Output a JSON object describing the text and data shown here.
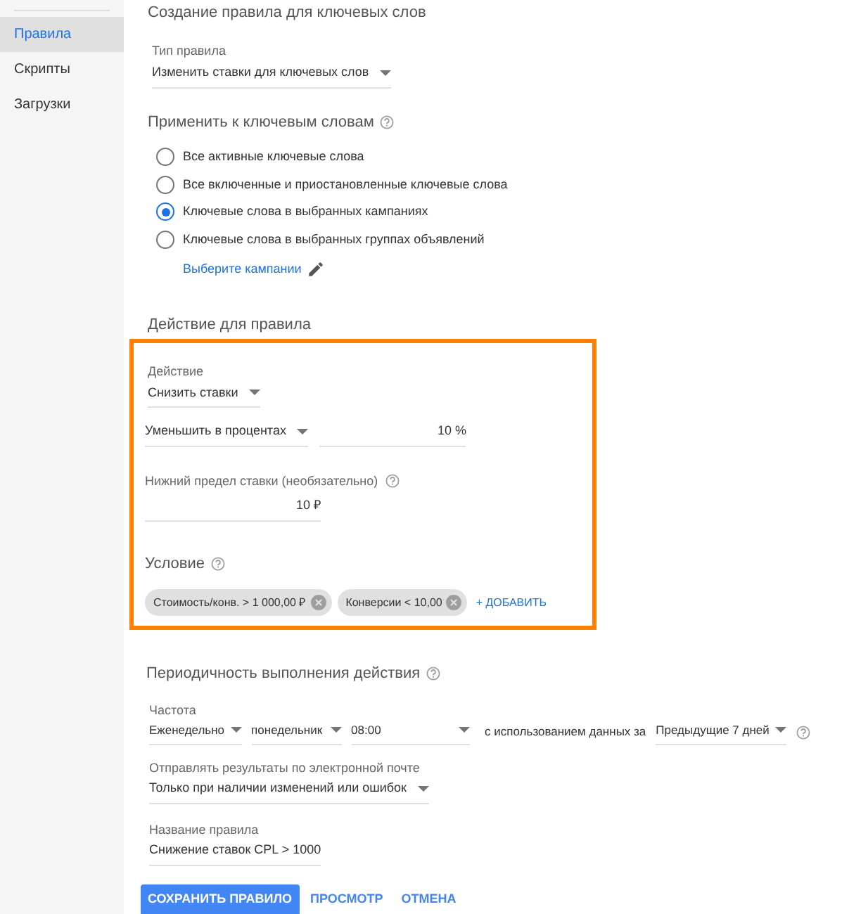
{
  "sidebar": {
    "items": [
      {
        "label": "Правила",
        "selected": true
      },
      {
        "label": "Скрипты",
        "selected": false
      },
      {
        "label": "Загрузки",
        "selected": false
      }
    ]
  },
  "rule_creation": {
    "title": "Создание правила для ключевых слов",
    "rule_type": {
      "label": "Тип правила",
      "value": "Изменить ставки для ключевых слов"
    }
  },
  "apply": {
    "title": "Применить к ключевым словам",
    "options": [
      {
        "label": "Все активные ключевые слова",
        "selected": false
      },
      {
        "label": "Все включенные и приостановленные ключевые слова",
        "selected": false
      },
      {
        "label": "Ключевые слова в выбранных кампаниях",
        "selected": true
      },
      {
        "label": "Ключевые слова в выбранных группах объявлений",
        "selected": false
      }
    ],
    "link": "Выберите кампании"
  },
  "action": {
    "title": "Действие для правила",
    "action_select": {
      "label": "Действие",
      "value": "Снизить ставки"
    },
    "adjust_select": {
      "value": "Уменьшить в процентах"
    },
    "amount": {
      "value": "10 %"
    },
    "lower_limit": {
      "label": "Нижний предел ставки (необязательно)",
      "value": "10 ₽"
    },
    "condition": {
      "title": "Условие",
      "chips": [
        {
          "label": "Стоимость/конв. > 1 000,00 ₽"
        },
        {
          "label": "Конверсии < 10,00"
        }
      ],
      "add_link": "+ ДОБАВИТЬ"
    }
  },
  "schedule": {
    "title": "Периодичность выполнения действия",
    "frequency": {
      "label": "Частота",
      "period": "Еженедельно",
      "day": "понедельник",
      "time": "08:00",
      "data_label": "с использованием данных за",
      "range": "Предыдущие 7 дней"
    },
    "email": {
      "label": "Отправлять результаты по электронной почте",
      "value": "Только при наличии изменений или ошибок"
    },
    "name": {
      "label": "Название правила",
      "value": "Снижение ставок CPL > 1000"
    }
  },
  "buttons": [
    {
      "label": "СОХРАНИТЬ ПРАВИЛО",
      "kind": "primary"
    },
    {
      "label": "ПРОСМОТР",
      "kind": "text"
    },
    {
      "label": "ОТМЕНА",
      "kind": "text"
    }
  ]
}
